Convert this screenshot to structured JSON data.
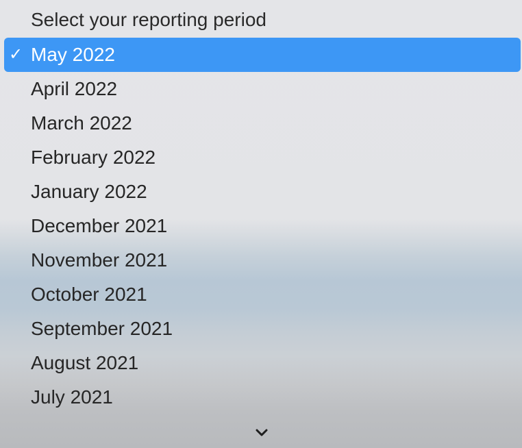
{
  "menu": {
    "header": "Select your reporting period",
    "selected_marker": "✓",
    "options": [
      {
        "label": "May 2022",
        "selected": true
      },
      {
        "label": "April 2022",
        "selected": false
      },
      {
        "label": "March 2022",
        "selected": false
      },
      {
        "label": "February 2022",
        "selected": false
      },
      {
        "label": "January 2022",
        "selected": false
      },
      {
        "label": "December 2021",
        "selected": false
      },
      {
        "label": "November 2021",
        "selected": false
      },
      {
        "label": "October 2021",
        "selected": false
      },
      {
        "label": "September 2021",
        "selected": false
      },
      {
        "label": "August 2021",
        "selected": false
      },
      {
        "label": "July 2021",
        "selected": false
      }
    ],
    "scroll_icon": "chevron-down-icon"
  },
  "colors": {
    "selection_highlight": "#3d97f5",
    "text": "#262626",
    "selected_text": "#ffffff"
  }
}
